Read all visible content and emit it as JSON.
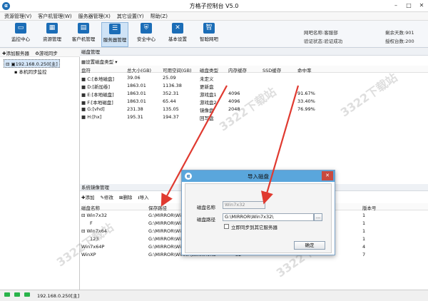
{
  "app": {
    "title": "方格子控制台 V5.0",
    "logo": "α"
  },
  "menu": [
    "资源管理(V)",
    "客户机管理(W)",
    "服务器管理(X)",
    "其它设置(Y)",
    "帮助(Z)"
  ],
  "toolbar": [
    {
      "label": "监控中心",
      "icon": "monitor-icon"
    },
    {
      "label": "资源管理",
      "icon": "resource-icon"
    },
    {
      "label": "客户机管理",
      "icon": "client-icon"
    },
    {
      "label": "服务器管理",
      "icon": "server-icon"
    },
    {
      "label": "安全中心",
      "icon": "shield-icon"
    },
    {
      "label": "基本设置",
      "icon": "tools-icon"
    },
    {
      "label": "智聪网吧",
      "icon": "zhi-icon"
    }
  ],
  "account": {
    "netbar_label": "网吧名称:",
    "netbar": "客服部",
    "auth_label": "验证状态:",
    "auth": "验证成功",
    "days_label": "剩余天数:",
    "days": "901",
    "seats_label": "授权台数:",
    "seats": "200"
  },
  "left": {
    "add_server": "添加服务器",
    "game_sync": "游戏同步",
    "server": "192.168.0.250[主]",
    "child": "本机同步监控"
  },
  "disk": {
    "section": "磁盘管理",
    "settype": "设置磁盘类型",
    "columns": [
      "盘符",
      "总大小(GB)",
      "可用空间(GB)",
      "磁盘类型",
      "内存缓存",
      "SSD缓存",
      "命中率"
    ],
    "rows": [
      [
        "C:[本地磁盘]",
        "39.06",
        "25.09",
        "未定义",
        "",
        "",
        ""
      ],
      [
        "D:[新加卷]",
        "1863.01",
        "1136.38",
        "更新盘",
        "",
        "",
        ""
      ],
      [
        "E:[本地磁盘]",
        "1863.01",
        "352.31",
        "游戏盘1",
        "4096",
        "",
        "91.67%"
      ],
      [
        "F:[本地磁盘]",
        "1863.01",
        "65.44",
        "游戏盘2",
        "4096",
        "",
        "33.40%"
      ],
      [
        "G:[vhd]",
        "231.38",
        "135.05",
        "镜像盘",
        "2048",
        "",
        "76.99%"
      ],
      [
        "H:[hx]",
        "195.31",
        "194.37",
        "回写盘",
        "",
        "",
        ""
      ]
    ]
  },
  "mirror": {
    "section": "系统镜像管理",
    "add": "添加",
    "edit": "修改",
    "delete": "删除",
    "import": "导入",
    "columns": [
      "磁盘名称",
      "保存路径",
      "",
      "版本号"
    ],
    "rows": [
      {
        "name": "Win7x32",
        "path": "G:\\MIRROR\\Wi",
        "size": "",
        "ver": "1",
        "expand": "⊟"
      },
      {
        "name": "F",
        "path": "G:\\MIRROR\\Wi",
        "size": "",
        "ver": "1",
        "expand": ""
      },
      {
        "name": "Win7x64",
        "path": "G:\\MIRROR\\Wi",
        "size": "",
        "ver": "1",
        "expand": "⊟"
      },
      {
        "name": "123",
        "path": "G:\\MIRROR\\Wi",
        "size": "",
        "ver": "1",
        "expand": ""
      },
      {
        "name": "Win7x64P",
        "path": "G:\\MIRROR\\Wi",
        "size": "",
        "ver": "4",
        "expand": ""
      },
      {
        "name": "WinXP",
        "path": "G:\\MIRROR\\WinXP\\WinXP.vhd",
        "size": "32",
        "ver": "7",
        "expand": ""
      }
    ]
  },
  "dialog": {
    "title": "导入磁盘",
    "name_label": "磁盘名称",
    "name_value": "Win7x32",
    "path_label": "磁盘路径",
    "path_value": "G:\\MIRROR\\Win7x32\\",
    "browse": "...",
    "sync_label": "立即同步到其它服务器",
    "ok": "确定"
  },
  "status": {
    "server": "192.168.0.250[主]"
  },
  "watermark": "3322下载站",
  "colors": {
    "accent": "#1b6db7",
    "arrow": "#e03a30",
    "dialog_title": "#5aa6dc",
    "led": "#29b34a"
  }
}
